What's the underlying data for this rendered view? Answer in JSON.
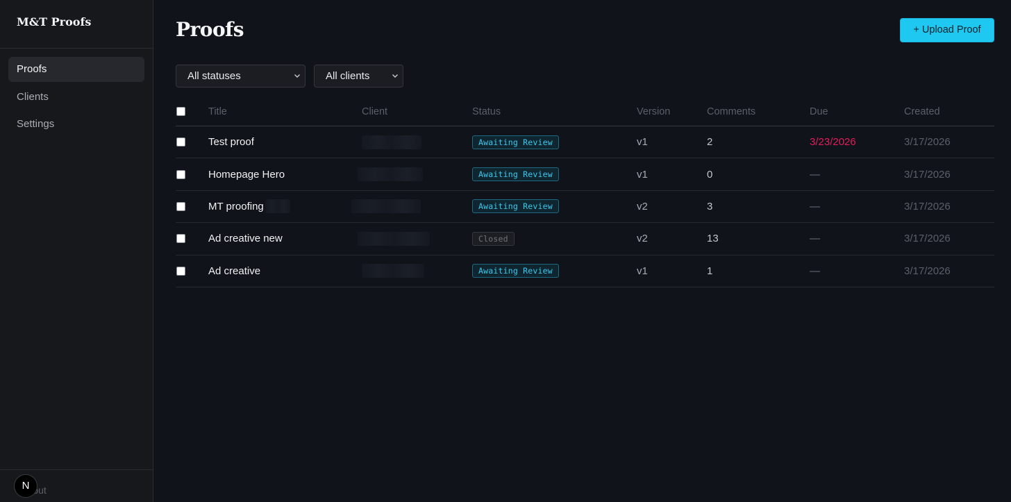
{
  "app": {
    "brand": "M&T Proofs"
  },
  "sidebar": {
    "items": [
      {
        "label": "Proofs",
        "active": true
      },
      {
        "label": "Clients",
        "active": false
      },
      {
        "label": "Settings",
        "active": false
      }
    ],
    "footer": {
      "logout_label": "Logout",
      "avatar_letter": "N"
    }
  },
  "main": {
    "title": "Proofs",
    "upload_button": "+ Upload Proof",
    "filters": {
      "status": "All statuses",
      "client": "All clients"
    }
  },
  "table": {
    "headers": {
      "title": "Title",
      "client": "Client",
      "status": "Status",
      "version": "Version",
      "comments": "Comments",
      "due": "Due",
      "created": "Created"
    },
    "rows": [
      {
        "title": "Test proof",
        "status": "Awaiting Review",
        "version": "v1",
        "comments": "2",
        "due": "3/23/2026",
        "created": "3/17/2026"
      },
      {
        "title": "Homepage Hero",
        "status": "Awaiting Review",
        "version": "v1",
        "comments": "0",
        "due": "—",
        "created": "3/17/2026"
      },
      {
        "title": "MT proofing",
        "status": "Awaiting Review",
        "version": "v2",
        "comments": "3",
        "due": "—",
        "created": "3/17/2026"
      },
      {
        "title": "Ad creative new",
        "status": "Closed",
        "version": "v2",
        "comments": "13",
        "due": "—",
        "created": "3/17/2026"
      },
      {
        "title": "Ad creative",
        "status": "Awaiting Review",
        "version": "v1",
        "comments": "1",
        "due": "—",
        "created": "3/17/2026"
      }
    ]
  },
  "colors": {
    "accent": "#1ec8f0",
    "overdue": "#e21f5a",
    "background": "#10131a",
    "sidebar": "#17181c"
  }
}
